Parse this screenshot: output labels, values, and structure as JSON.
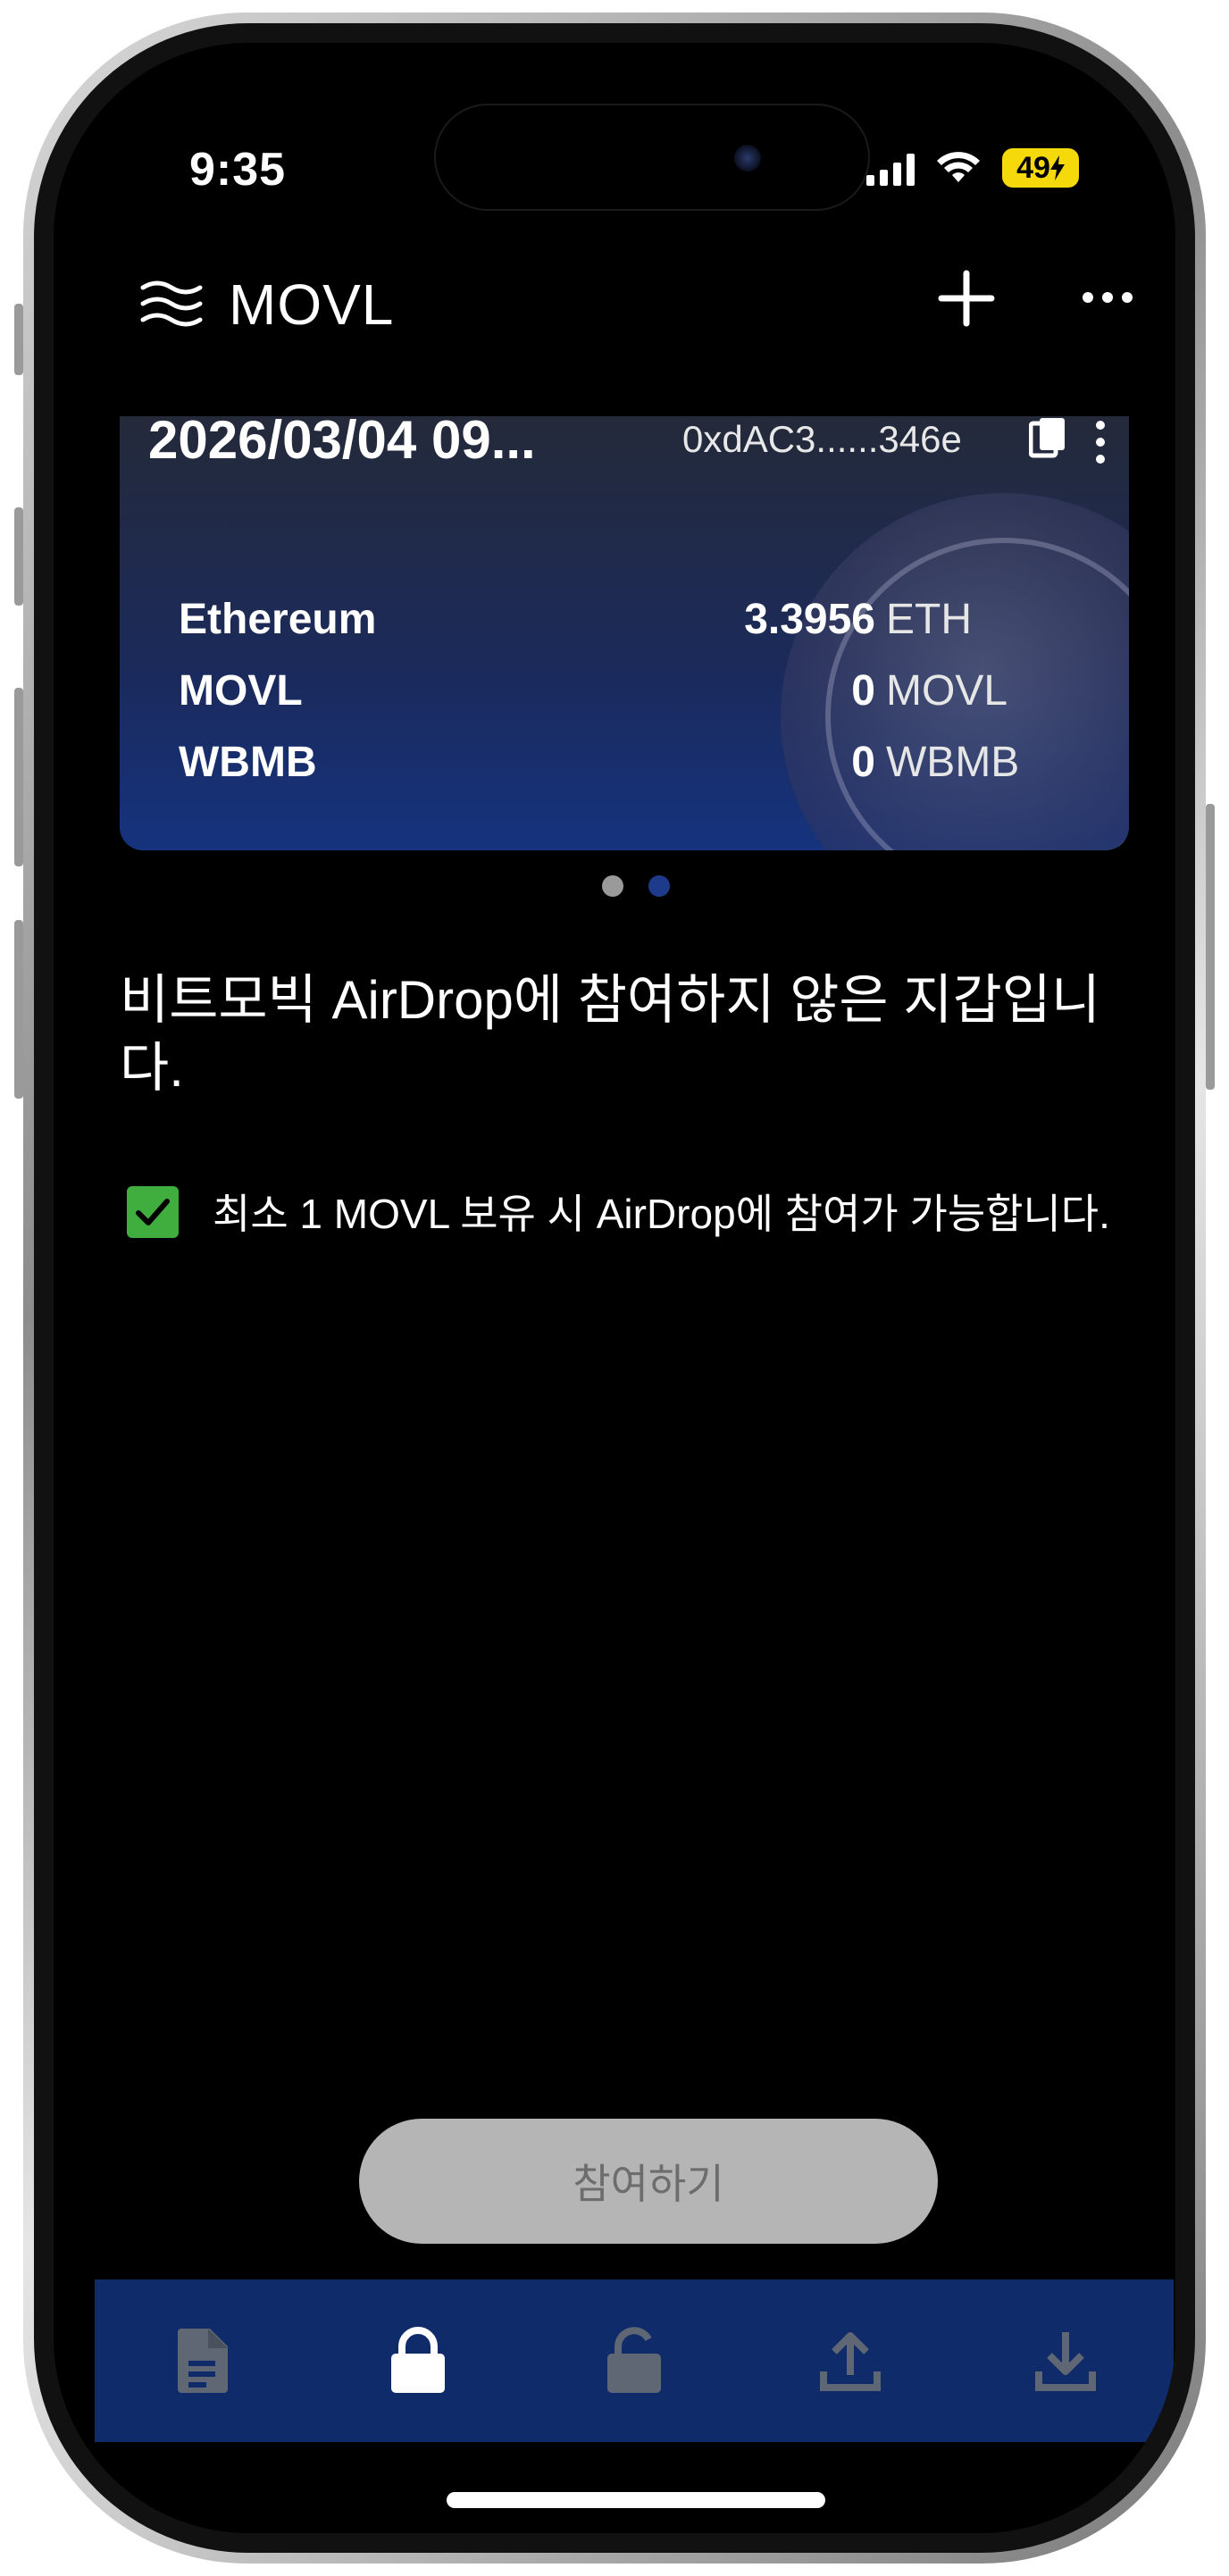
{
  "status_bar": {
    "time": "9:35",
    "battery": "49"
  },
  "header": {
    "title": "MOVL"
  },
  "card": {
    "date": "2026/03/04 09...",
    "address": "0xdAC3......346e",
    "tokens": [
      {
        "name": "Ethereum",
        "amount": "3.3956",
        "unit": "ETH"
      },
      {
        "name": "MOVL",
        "amount": "0",
        "unit": "MOVL"
      },
      {
        "name": "WBMB",
        "amount": "0",
        "unit": "WBMB"
      }
    ]
  },
  "pager": {
    "count": 2,
    "active_index": 1,
    "active_color": "#1e3a8a",
    "inactive_color": "#9a9a9a"
  },
  "message": "비트모빅 AirDrop에 참여하지 않은 지갑입니다.",
  "requirement": {
    "checked": true,
    "text": "최소 1 MOVL 보유 시 AirDrop에 참여가 가능합니다."
  },
  "join_button": {
    "label": "참여하기",
    "enabled": false
  },
  "bottom_nav": {
    "items": [
      {
        "icon": "document-icon",
        "active": false
      },
      {
        "icon": "lock-icon",
        "active": true
      },
      {
        "icon": "unlock-icon",
        "active": false
      },
      {
        "icon": "upload-icon",
        "active": false
      },
      {
        "icon": "download-icon",
        "active": false
      }
    ]
  },
  "colors": {
    "nav_bg": "#102b6a",
    "check_green": "#3fae3f",
    "accent_yellow": "#f5d90a"
  }
}
